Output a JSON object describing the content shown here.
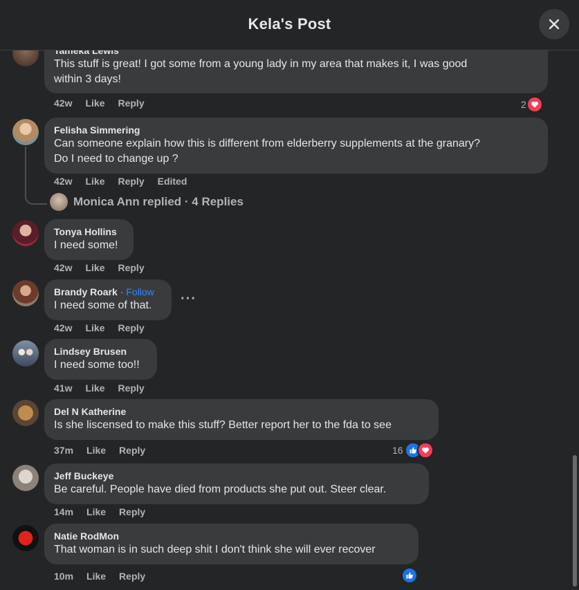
{
  "header": {
    "title": "Kela's Post"
  },
  "comments": [
    {
      "author": "Tameka Lewis",
      "text_lines": [
        "This stuff is great! I got some from a young lady in my area that makes it, I was good",
        "within 3 days!"
      ],
      "time": "42w",
      "like": "Like",
      "reply": "Reply",
      "reaction_count": "2",
      "reactions": [
        "heart"
      ]
    },
    {
      "author": "Felisha Simmering",
      "text_lines": [
        "Can someone explain how this is different from elderberry supplements at the granary?",
        "Do I need to change up ?"
      ],
      "time": "42w",
      "like": "Like",
      "reply": "Reply",
      "edited": "Edited",
      "replies_summary": "Monica Ann replied · 4 Replies"
    },
    {
      "author": "Tonya Hollins",
      "text": "I need some!",
      "time": "42w",
      "like": "Like",
      "reply": "Reply"
    },
    {
      "author": "Brandy Roark",
      "follow": "Follow",
      "sep": " · ",
      "text": "I need some of that.",
      "time": "42w",
      "like": "Like",
      "reply": "Reply",
      "more": "···"
    },
    {
      "author": "Lindsey Brusen",
      "text": "I need some too!!",
      "time": "41w",
      "like": "Like",
      "reply": "Reply"
    },
    {
      "author": "Del N Katherine",
      "text": "Is she liscensed to make this stuff? Better report her to the fda to see",
      "time": "37m",
      "like": "Like",
      "reply": "Reply",
      "reaction_count": "16",
      "reactions": [
        "like",
        "heart"
      ]
    },
    {
      "author": "Jeff Buckeye",
      "text": "Be careful. People have died from products she put out. Steer clear.",
      "time": "14m",
      "like": "Like",
      "reply": "Reply"
    },
    {
      "author": "Natie RodMon",
      "text": "That woman is in such deep shit I don't think she will ever recover",
      "time": "10m",
      "like": "Like",
      "reply": "Reply",
      "reactions": [
        "like"
      ]
    }
  ],
  "icons": {
    "close": "close-icon",
    "heart": "heart-reaction-icon",
    "like": "like-reaction-icon"
  },
  "colors": {
    "background": "#242526",
    "bubble": "#3a3b3c",
    "text": "#e4e6eb",
    "muted": "#b0b3b8",
    "accent": "#2d88ff",
    "heart": "#f33e58",
    "like": "#1b74e4"
  }
}
